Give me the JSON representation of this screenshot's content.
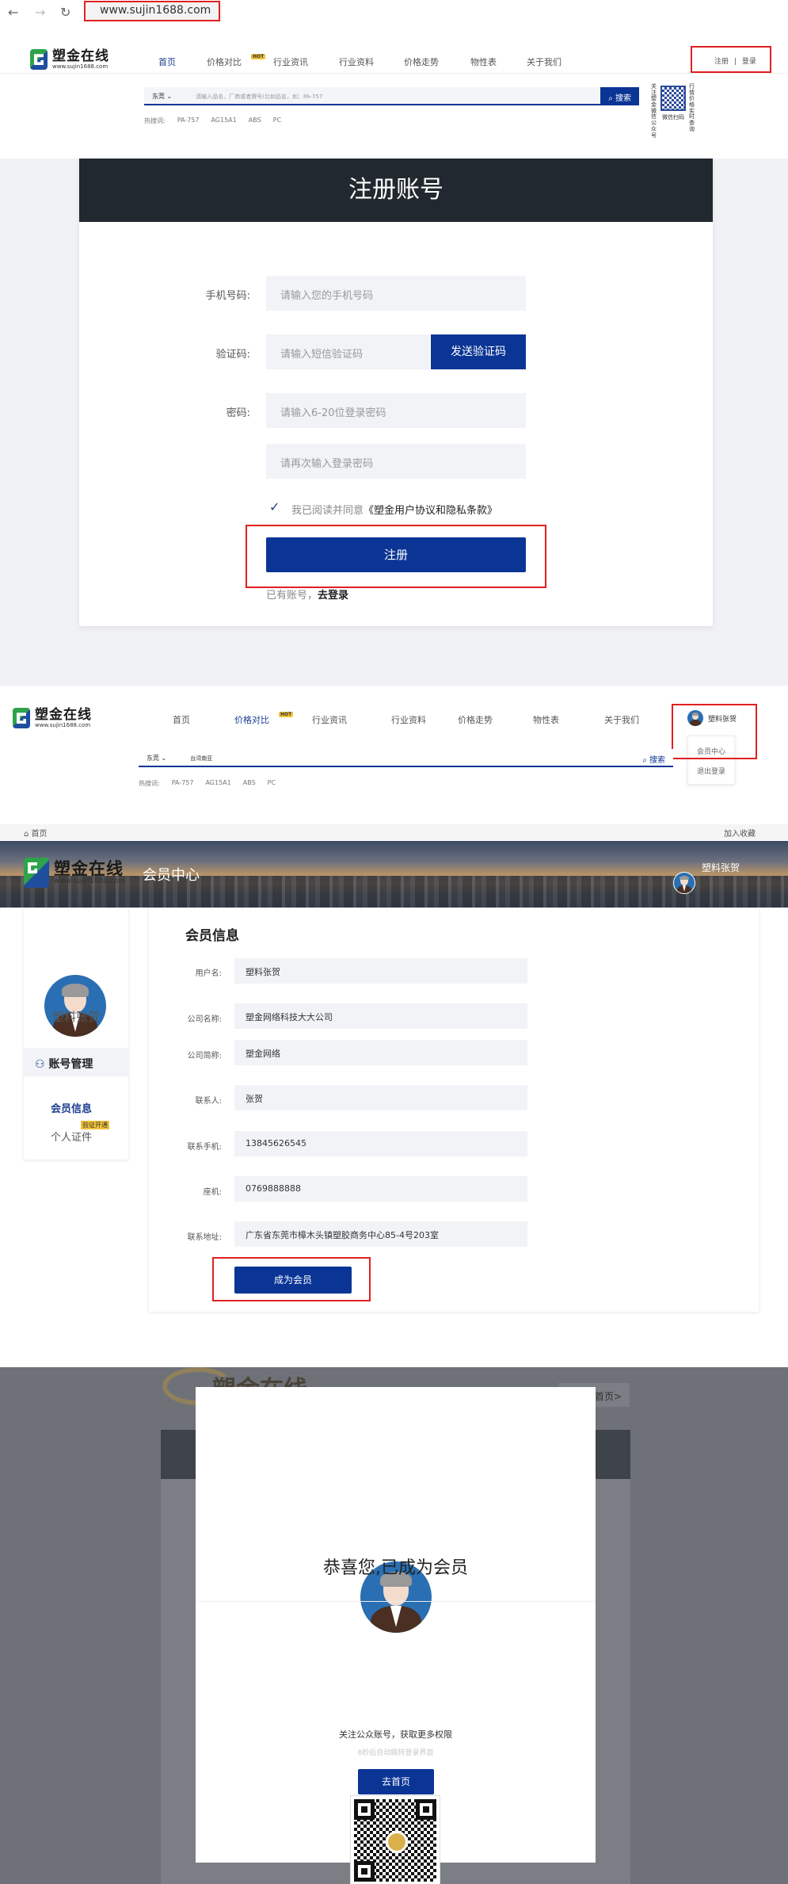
{
  "browser": {
    "url": "www.sujin1688.com"
  },
  "brand": {
    "name": "塑金在线",
    "domain": "www.sujin1688.com"
  },
  "nav": {
    "items": [
      "首页",
      "价格对比",
      "行业资讯",
      "行业资料",
      "价格走势",
      "物性表",
      "关于我们"
    ],
    "hot_badge": "HOT"
  },
  "header1": {
    "register": "注册",
    "divider": "|",
    "login": "登录"
  },
  "search": {
    "city": "东莞",
    "placeholder": "请输入品名、厂商或者牌号(比如品名，如：PA-757",
    "button": "搜索",
    "hot_label": "热搜词:",
    "hot_words": [
      "PA-757",
      "AG15A1",
      "ABS",
      "PC"
    ],
    "qr_left": "关注塑金微信公众号",
    "qr_right": "行情价格实时查询",
    "qr_caption": "微信扫码"
  },
  "register": {
    "title": "注册账号",
    "phone_label": "手机号码:",
    "phone_ph": "请输入您的手机号码",
    "code_label": "验证码:",
    "code_ph": "请输入短信验证码",
    "send_code": "发送验证码",
    "pwd_label": "密码:",
    "pwd_ph": "请输入6-20位登录密码",
    "pwd2_ph": "请再次输入登录密码",
    "agree_text": "我已阅读并同意",
    "agree_link": "《塑金用户协议和隐私条款》",
    "submit": "注册",
    "have_account": "已有账号，",
    "go_login": "去登录"
  },
  "header2": {
    "search_value": "台湾南亚",
    "username": "塑料张贺",
    "menu": [
      "会员中心",
      "退出登录"
    ]
  },
  "member": {
    "home": "首页",
    "favorite": "加入收藏",
    "center_title": "会员中心",
    "username": "塑料张贺",
    "side_title": "账号管理",
    "side_items": [
      "会员信息",
      "个人证件"
    ],
    "verify_badge": "验证开通",
    "section_title": "会员信息",
    "fields": [
      {
        "label": "用户名:",
        "value": "塑料张贺"
      },
      {
        "label": "公司名称:",
        "value": "塑金网络科技大大公司"
      },
      {
        "label": "公司简称:",
        "value": "塑金网络"
      },
      {
        "label": "联系人:",
        "value": "张贺"
      },
      {
        "label": "联系手机:",
        "value": "13845626545"
      },
      {
        "label": "座机:",
        "value": "0769888888"
      },
      {
        "label": "联系地址:",
        "value": "广东省东莞市樟木头镇塑胶商务中心85-4号203室"
      }
    ],
    "become_member": "成为会员"
  },
  "modal": {
    "bg_brand": "塑金在线",
    "bg_button": "首页>",
    "congrats": "恭喜您,已成为会员",
    "follow": "关注公众账号，获取更多权限",
    "redirect": "8秒后自动跳转登录界面",
    "home_button": "去首页"
  },
  "colors": {
    "primary": "#0b3595",
    "header_dark": "#22282f",
    "highlight": "#e02020"
  }
}
